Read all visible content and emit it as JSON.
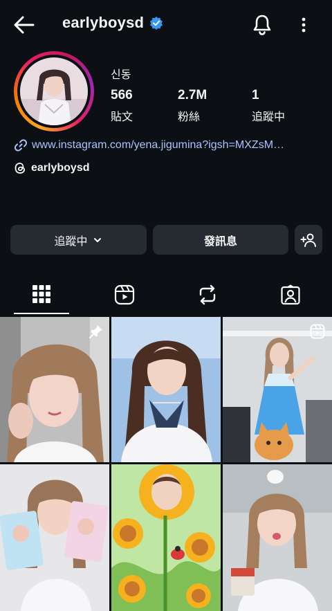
{
  "header": {
    "username": "earlyboysd",
    "icons": {
      "back": "arrow-left-icon",
      "verified": "verified-badge-icon",
      "notifications": "bell-icon",
      "more": "more-vertical-icon"
    }
  },
  "profile": {
    "display_name": "신동",
    "stats": [
      {
        "value": "566",
        "label": "貼文"
      },
      {
        "value": "2.7M",
        "label": "粉絲"
      },
      {
        "value": "1",
        "label": "追蹤中"
      }
    ],
    "link": "www.instagram.com/yena.jigumina?igsh=MXZsM…",
    "threads_handle": "earlyboysd"
  },
  "actions": {
    "following_label": "追蹤中",
    "message_label": "發訊息"
  },
  "tabs": [
    {
      "name": "posts",
      "icon": "grid-icon",
      "active": true
    },
    {
      "name": "reels",
      "icon": "reels-icon",
      "active": false
    },
    {
      "name": "reposts",
      "icon": "repost-icon",
      "active": false
    },
    {
      "name": "tagged",
      "icon": "tagged-person-icon",
      "active": false
    }
  ],
  "grid_posts": [
    {
      "overlay_icon": "pin-icon"
    },
    {
      "overlay_icon": ""
    },
    {
      "overlay_icon": "reels-icon"
    },
    {
      "overlay_icon": ""
    },
    {
      "overlay_icon": ""
    },
    {
      "overlay_icon": ""
    }
  ],
  "colors": {
    "background": "#0c0f14",
    "button": "#262a31",
    "link": "#a9c4ff",
    "verified": "#3897f0"
  }
}
